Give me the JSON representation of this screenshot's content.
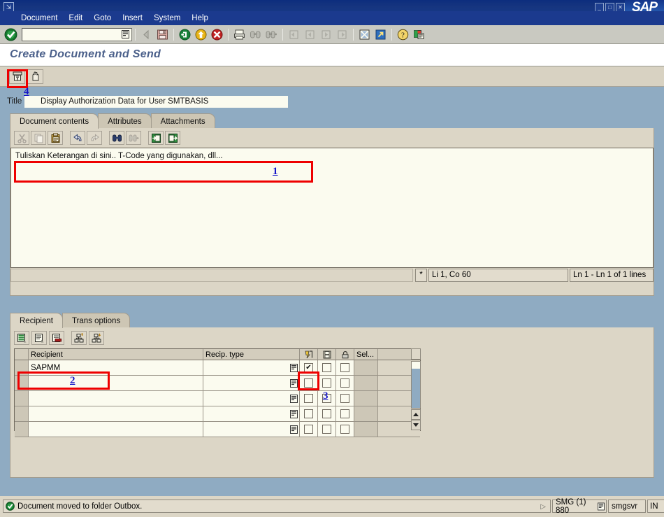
{
  "window": {
    "sap_logo": "SAP",
    "system_icon": "system-menu-icon",
    "buttons": [
      "minimize",
      "maximize",
      "close"
    ]
  },
  "menubar": {
    "items": [
      {
        "label": "Document",
        "name": "menu-document"
      },
      {
        "label": "Edit",
        "name": "menu-edit"
      },
      {
        "label": "Goto",
        "name": "menu-goto"
      },
      {
        "label": "Insert",
        "name": "menu-insert"
      },
      {
        "label": "System",
        "name": "menu-system"
      },
      {
        "label": "Help",
        "name": "menu-help"
      }
    ]
  },
  "toolbar": {
    "command_value": "",
    "command_placeholder": "",
    "icons": [
      "enter-check-icon",
      "back-icon",
      "save-icon",
      "exit-icon",
      "cancel-icon",
      "print-icon",
      "find-icon",
      "find-next-icon",
      "first-page-icon",
      "previous-page-icon",
      "next-page-icon",
      "last-page-icon",
      "new-session-icon",
      "create-shortcut-icon",
      "help-icon",
      "customize-icon"
    ]
  },
  "program": {
    "title": "Create Document and Send"
  },
  "app_toolbar": {
    "buttons": [
      {
        "name": "send-document-button",
        "icon": "send-document-icon"
      },
      {
        "name": "hold-document-button",
        "icon": "hand-hold-icon"
      }
    ]
  },
  "title_field": {
    "label": "Title",
    "value": "Display Authorization Data for User SMTBASIS"
  },
  "doc_tabs": {
    "items": [
      {
        "label": "Document contents",
        "active": true
      },
      {
        "label": "Attributes",
        "active": false
      },
      {
        "label": "Attachments",
        "active": false
      }
    ]
  },
  "editor_toolbar": {
    "buttons": [
      {
        "name": "cut-button",
        "icon": "scissors-icon"
      },
      {
        "name": "copy-button",
        "icon": "copy-icon"
      },
      {
        "name": "paste-button",
        "icon": "clipboard-paste-icon"
      },
      {
        "name": "undo-button",
        "icon": "undo-arrow-icon"
      },
      {
        "name": "redo-button",
        "icon": "redo-arrow-icon"
      },
      {
        "name": "find-button",
        "icon": "binoculars-icon"
      },
      {
        "name": "find-next-button",
        "icon": "binoculars-plus-icon"
      },
      {
        "name": "upload-button",
        "icon": "import-text-icon"
      },
      {
        "name": "download-button",
        "icon": "export-text-icon"
      }
    ]
  },
  "editor": {
    "text": "Tuliskan Keterangan di sini.. T-Code yang digunakan, dll...",
    "status": {
      "modified_flag": "*",
      "position": "Li 1, Co 60",
      "lines": "Ln 1 - Ln 1 of 1 lines"
    }
  },
  "recipient_tabs": {
    "items": [
      {
        "label": "Recipient",
        "active": true
      },
      {
        "label": "Trans options",
        "active": false
      }
    ]
  },
  "recipient_toolbar": {
    "buttons": [
      {
        "name": "insert-row-button",
        "icon": "insert-line-icon"
      },
      {
        "name": "detail-button",
        "icon": "detail-line-icon"
      },
      {
        "name": "delete-row-button",
        "icon": "delete-line-icon"
      },
      {
        "name": "sort-ascending-button",
        "icon": "sort-ascending-icon"
      },
      {
        "name": "sort-descending-button",
        "icon": "sort-descending-icon"
      }
    ]
  },
  "recipient_grid": {
    "columns": [
      {
        "label": "Recipient",
        "name": "column-recipient"
      },
      {
        "label": "Recip. type",
        "name": "column-recipient-type"
      },
      {
        "label": "",
        "name": "column-express",
        "icon": "express-mail-icon"
      },
      {
        "label": "",
        "name": "column-copy",
        "icon": "copy-flag-icon"
      },
      {
        "label": "",
        "name": "column-lock",
        "icon": "lock-icon"
      },
      {
        "label": "Sel...",
        "name": "column-selection"
      }
    ],
    "rows": [
      {
        "recipient": "SAPMM",
        "recip_type": "",
        "express": true,
        "copy": false,
        "lock": false,
        "sel": ""
      },
      {
        "recipient": "",
        "recip_type": "",
        "express": false,
        "copy": false,
        "lock": false,
        "sel": ""
      },
      {
        "recipient": "",
        "recip_type": "",
        "express": false,
        "copy": false,
        "lock": false,
        "sel": ""
      },
      {
        "recipient": "",
        "recip_type": "",
        "express": false,
        "copy": false,
        "lock": false,
        "sel": ""
      },
      {
        "recipient": "",
        "recip_type": "",
        "express": false,
        "copy": false,
        "lock": false,
        "sel": ""
      }
    ],
    "check_glyph": "✔"
  },
  "statusbar": {
    "icon": "status-success-icon",
    "message": "Document moved to folder Outbox.",
    "expand_glyph": "▷",
    "system": "SMG (1) 880",
    "server": "smgsvr",
    "insert_mode": "IN"
  },
  "annotations": [
    {
      "number": "1",
      "target": "editor-text-line"
    },
    {
      "number": "2",
      "target": "recipient-cell-sapmm"
    },
    {
      "number": "3",
      "target": "express-checkbox"
    },
    {
      "number": "4",
      "target": "send-document-button"
    }
  ],
  "colors": {
    "annotation_box": "#ee0000",
    "annotation_number": "#1414c8",
    "canvas_blue": "#8fabc2",
    "panel_beige": "#dcd6c6",
    "field_cream": "#fbfbef",
    "titlebar_blue": "#16357f"
  }
}
